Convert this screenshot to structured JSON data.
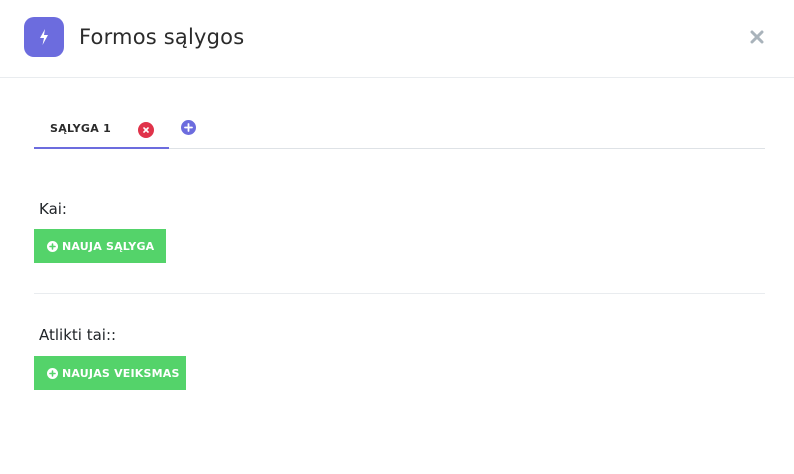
{
  "header": {
    "title": "Formos sąlygos",
    "icon": "lightning-icon",
    "accent_color": "#6c6cde"
  },
  "tabs": [
    {
      "label": "SĄLYGA 1",
      "active": true
    }
  ],
  "when_section": {
    "label": "Kai:",
    "button_label": "NAUJA SĄLYGA"
  },
  "then_section": {
    "label": "Atlikti tai::",
    "button_label": "NAUJAS VEIKSMAS"
  },
  "colors": {
    "accent": "#6c6cde",
    "success": "#54d36a",
    "danger": "#e0334a",
    "close": "#a9b3bb"
  }
}
